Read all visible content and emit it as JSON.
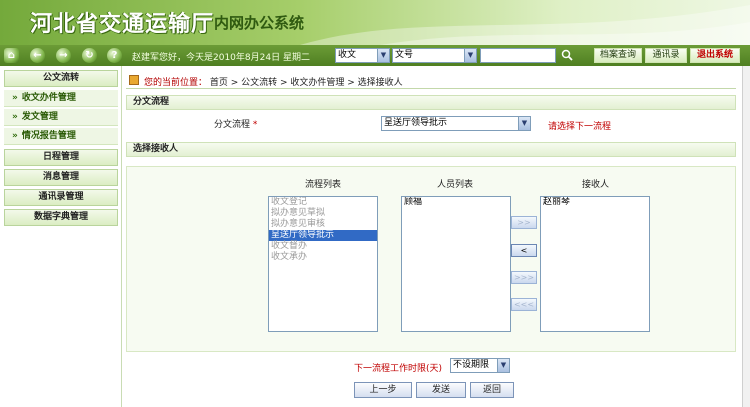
{
  "banner": {
    "title": "河北省交通运输厅",
    "subtitle": "内网办公系统"
  },
  "toolbar": {
    "welcome": "赵建军您好，今天是2010年8月24日 星期二",
    "select_type": "收文",
    "select_field": "文号",
    "search_value": "",
    "archive_btn": "档案查询",
    "contacts_btn": "通讯录",
    "exit_btn": "退出系统"
  },
  "nav": {
    "items": [
      {
        "label": "公文流转",
        "kind": "head"
      },
      {
        "label": "收文办件管理",
        "kind": "sub"
      },
      {
        "label": "发文管理",
        "kind": "sub"
      },
      {
        "label": "情况报告管理",
        "kind": "sub"
      },
      {
        "label": "日程管理",
        "kind": "head"
      },
      {
        "label": "消息管理",
        "kind": "head"
      },
      {
        "label": "通讯录管理",
        "kind": "head"
      },
      {
        "label": "数据字典管理",
        "kind": "head"
      }
    ]
  },
  "breadcrumb": {
    "label": "您的当前位置：",
    "path": "首页  > 公文流转  > 收文办件管理  > 选择接收人"
  },
  "branch": {
    "section_title": "分文流程",
    "field_label": "分文流程",
    "required_mark": "*",
    "select_value": "呈送厅领导批示",
    "hint": "请选择下一流程"
  },
  "receiver": {
    "section_title": "选择接收人",
    "flow_list_label": "流程列表",
    "flow_items": [
      "收文登记",
      "拟办意见草拟",
      "拟办意见审核",
      "呈送厅领导批示",
      "收文督办",
      "收文承办"
    ],
    "flow_selected_index": 3,
    "people_list_label": "人员列表",
    "people_items": [
      "顾福"
    ],
    "recipients_label": "接收人",
    "recipient_items": [
      "赵丽琴"
    ],
    "move_buttons": [
      ">>",
      "<",
      ">>>",
      "<<<"
    ]
  },
  "deadline": {
    "label": "下一流程工作时限(天)",
    "value": "不设期限"
  },
  "actions": {
    "prev": "上一步",
    "send": "发送",
    "back": "返回"
  }
}
